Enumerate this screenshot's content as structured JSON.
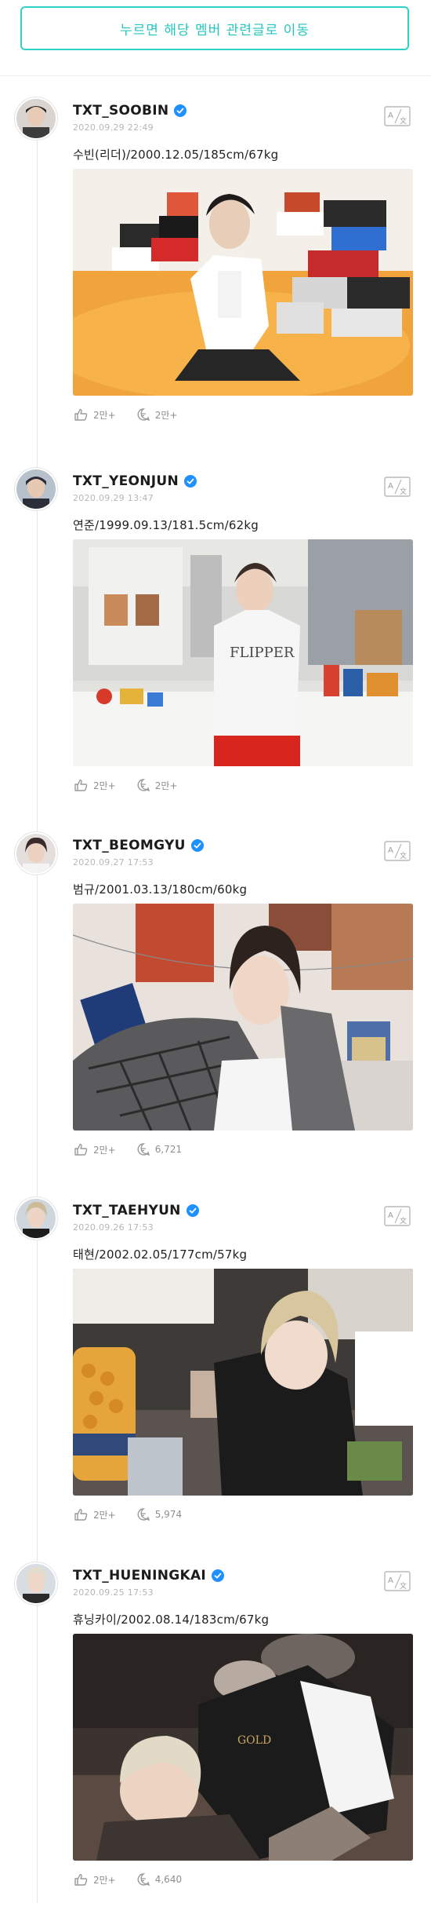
{
  "banner": {
    "text": "누르면 해당 멤버 관련글로 이동"
  },
  "colors": {
    "accent": "#2fd1c5",
    "verified": "#1e90ff"
  },
  "posts": [
    {
      "username": "TXT_SOOBIN",
      "timestamp": "2020.09.29 22:49",
      "caption": "수빈(리더)/2000.12.05/185cm/67kg",
      "likes": "2만+",
      "comments": "2만+",
      "photo": "soobin-sitting-with-shoeboxes"
    },
    {
      "username": "TXT_YEONJUN",
      "timestamp": "2020.09.29 13:47",
      "caption": "연준/1999.09.13/181.5cm/62kg",
      "likes": "2만+",
      "comments": "2만+",
      "photo": "yeonjun-kitchen-counter"
    },
    {
      "username": "TXT_BEOMGYU",
      "timestamp": "2020.09.27 17:53",
      "caption": "범규/2001.03.13/180cm/60kg",
      "likes": "2만+",
      "comments": "6,721",
      "photo": "beomgyu-lying-with-posters"
    },
    {
      "username": "TXT_TAEHYUN",
      "timestamp": "2020.09.26 17:53",
      "caption": "태현/2002.02.05/177cm/57kg",
      "likes": "2만+",
      "comments": "5,974",
      "photo": "taehyun-lying-with-snacks-jar"
    },
    {
      "username": "TXT_HUENINGKAI",
      "timestamp": "2020.09.25 17:53",
      "caption": "휴닝카이/2002.08.14/183cm/67kg",
      "likes": "2만+",
      "comments": "4,640",
      "photo": "hueningkai-lying-on-floor"
    }
  ]
}
